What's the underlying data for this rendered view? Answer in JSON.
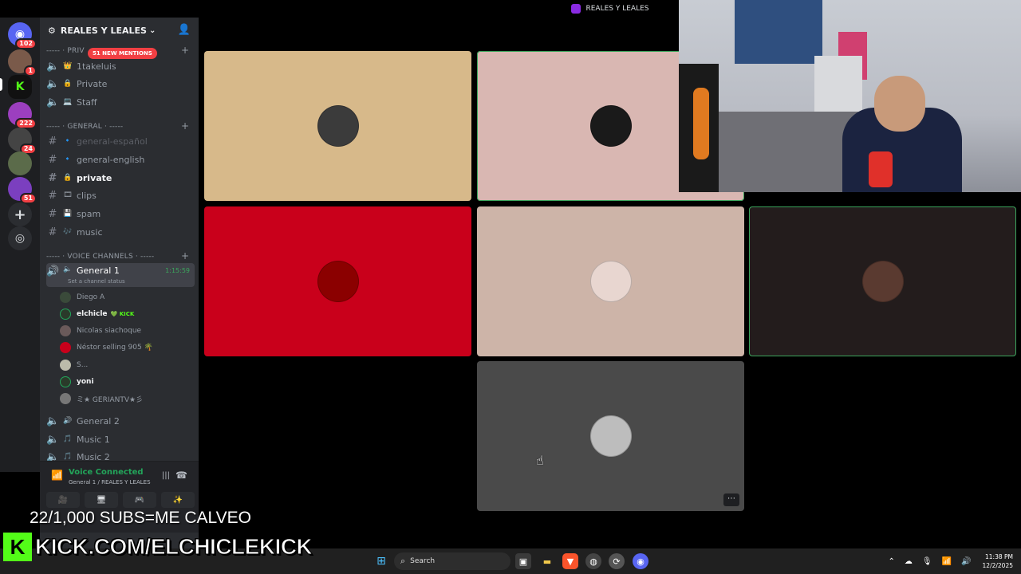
{
  "window": {
    "title": "REALES Y LEALES"
  },
  "rail": {
    "servers": [
      {
        "icon": "discord-home-icon",
        "badge": "102"
      },
      {
        "icon": "server-avatar-1",
        "badge": "1"
      },
      {
        "icon": "kick-server-icon",
        "badge": ""
      },
      {
        "icon": "server-avatar-2",
        "badge": "222"
      },
      {
        "icon": "server-avatar-3",
        "badge": "24"
      },
      {
        "icon": "server-avatar-4",
        "badge": ""
      },
      {
        "icon": "server-avatar-5",
        "badge": "51"
      }
    ],
    "add_server": "+",
    "discover": "◎"
  },
  "sidebar": {
    "server_name": "REALES Y LEALES",
    "mentions_banner": "51 NEW MENTIONS",
    "categories": {
      "private": "----- · PRIV",
      "general": "----- · GENERAL · -----",
      "voice": "----- · VOICE CHANNELS · -----"
    },
    "private_channels": [
      {
        "emoji": "👑",
        "label": "1takeluis"
      },
      {
        "emoji": "🔒",
        "label": "Private"
      },
      {
        "emoji": "💻",
        "label": "Staff"
      }
    ],
    "text_channels": [
      {
        "emoji": "🔹",
        "label": "general-español",
        "state": "muted"
      },
      {
        "emoji": "🔹",
        "label": "general-english",
        "state": "normal"
      },
      {
        "emoji": "🔒",
        "label": "private",
        "state": "bold"
      },
      {
        "emoji": "🎞",
        "label": "clips",
        "state": "normal"
      },
      {
        "emoji": "💾",
        "label": "spam",
        "state": "normal"
      },
      {
        "emoji": "🎶",
        "label": "music",
        "state": "normal"
      }
    ],
    "active_voice": {
      "label": "General 1",
      "time": "1:15:59",
      "status": "Set a channel status"
    },
    "voice_users": [
      {
        "name": "Diego A",
        "bold": false,
        "tag": ""
      },
      {
        "name": "elchicle",
        "bold": true,
        "tag": "💚 KICK"
      },
      {
        "name": "Nicolas siachoque",
        "bold": false,
        "tag": ""
      },
      {
        "name": "Néstor selling 905 🌴",
        "bold": false,
        "tag": ""
      },
      {
        "name": "S...",
        "bold": false,
        "tag": ""
      },
      {
        "name": "yoni",
        "bold": true,
        "tag": ""
      },
      {
        "name": "ミ★ GERIANTV★彡",
        "bold": false,
        "tag": ""
      }
    ],
    "other_voice": [
      {
        "emoji": "🔊",
        "label": "General 2"
      },
      {
        "emoji": "🎵",
        "label": "Music 1"
      },
      {
        "emoji": "🎵",
        "label": "Music 2"
      }
    ]
  },
  "voice_panel": {
    "title": "Voice Connected",
    "subtitle": "General 1 / REALES Y LEALES",
    "buttons": [
      "🎥",
      "🖥",
      "🎮",
      "✨"
    ]
  },
  "tiles": [
    {
      "bg": "#d7b98a",
      "avatar": "#3b3b3b",
      "speaking": false
    },
    {
      "bg": "#d9b7b2",
      "avatar": "#1a1a1a",
      "speaking": true
    },
    {
      "bg": "#c9001b",
      "avatar": "#8b0000",
      "speaking": false
    },
    {
      "bg": "#cdb4a8",
      "avatar": "#e8d6d0",
      "speaking": false
    },
    {
      "bg": "#231c1c",
      "avatar": "#5a3a30",
      "speaking": true
    },
    {
      "bg": "#4a4a4a",
      "avatar": "#bdbdbd",
      "speaking": false
    }
  ],
  "overlay": {
    "subs": "22/1,000 SUBS=ME CALVEO",
    "kick_logo": "K",
    "kick_url": "KICK.COM/ELCHICLEKICK"
  },
  "taskbar": {
    "search": "Search",
    "time": "11:38 PM",
    "date": "12/2/2025"
  }
}
